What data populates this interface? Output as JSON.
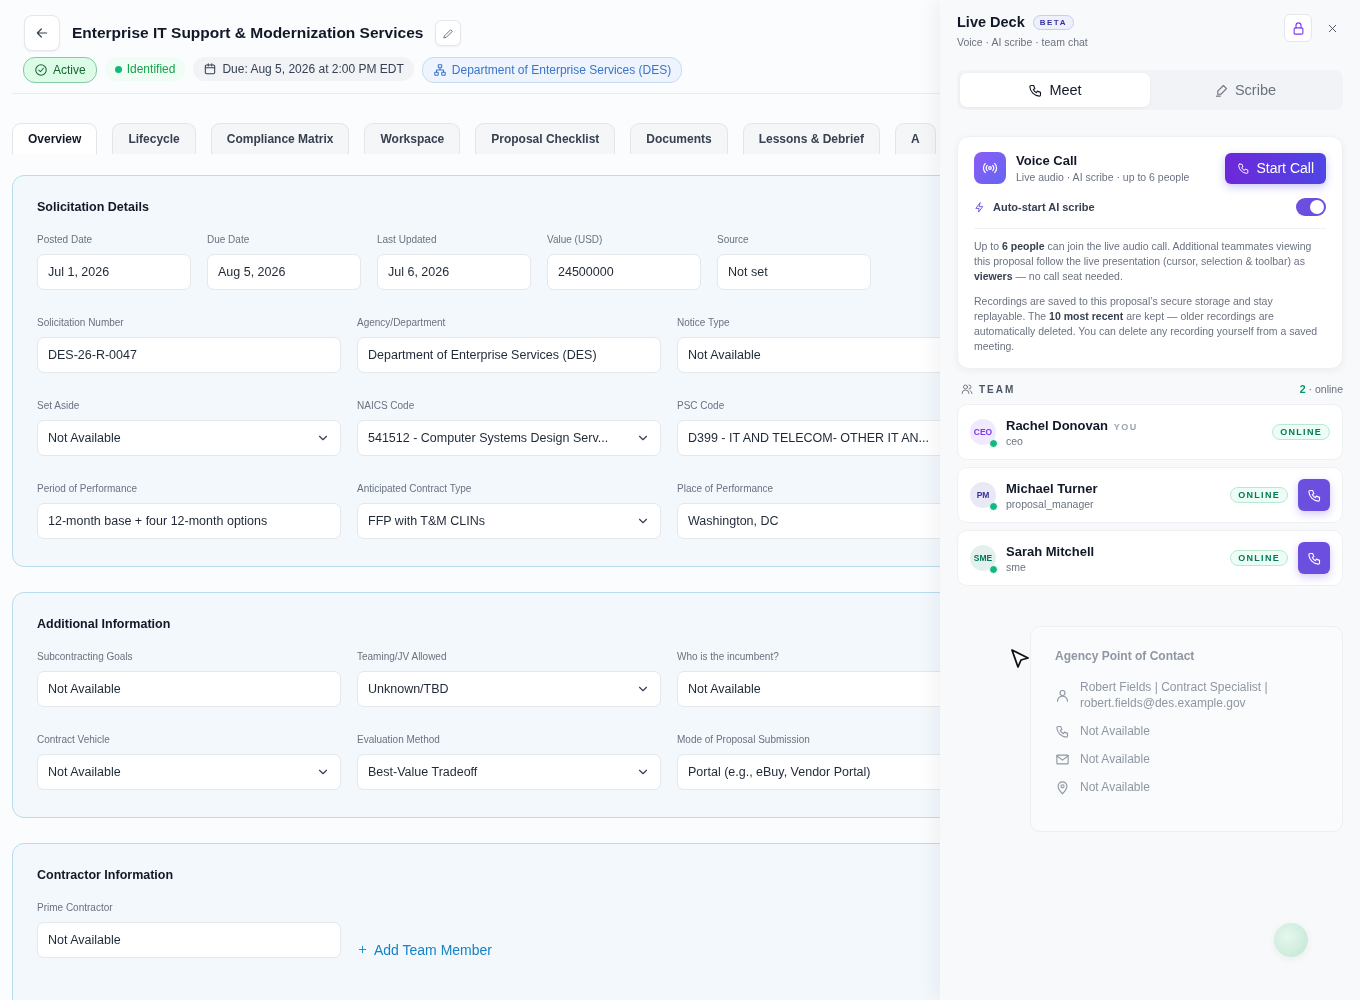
{
  "header": {
    "title": "Enterprise IT Support & Modernization Services",
    "badges": [
      {
        "kind": "status",
        "label": "Active"
      },
      {
        "kind": "stage",
        "label": "Identified"
      },
      {
        "kind": "due",
        "label": "Due: Aug 5, 2026 at 2:00 PM EDT"
      },
      {
        "kind": "agency",
        "label": "Department of Enterprise Services (DES)"
      }
    ]
  },
  "tabs": [
    {
      "label": "Overview",
      "selected": true
    },
    {
      "label": "Lifecycle",
      "selected": false
    },
    {
      "label": "Compliance Matrix",
      "selected": false
    },
    {
      "label": "Workspace",
      "selected": false
    },
    {
      "label": "Proposal Checklist",
      "selected": false
    },
    {
      "label": "Documents",
      "selected": false
    },
    {
      "label": "Lessons & Debrief",
      "selected": false
    },
    {
      "label": "A",
      "selected": false
    }
  ],
  "sections": [
    {
      "title": "Solicitation Details",
      "rows": [
        {
          "kind": "narrow",
          "fields": [
            {
              "label": "Posted Date",
              "value": "Jul 1, 2026",
              "kind": "text"
            },
            {
              "label": "Due Date",
              "value": "Aug 5, 2026",
              "kind": "text"
            },
            {
              "label": "Last Updated",
              "value": "Jul 6, 2026",
              "kind": "text"
            },
            {
              "label": "Value (USD)",
              "value": "24500000",
              "kind": "text"
            },
            {
              "label": "Source",
              "value": "Not set",
              "kind": "text"
            }
          ]
        },
        {
          "kind": "wide",
          "fields": [
            {
              "label": "Solicitation Number",
              "value": "DES-26-R-0047",
              "kind": "text"
            },
            {
              "label": "Agency/Department",
              "value": "Department of Enterprise Services (DES)",
              "kind": "text"
            },
            {
              "label": "Notice Type",
              "value": "Not Available",
              "kind": "text"
            }
          ]
        },
        {
          "kind": "wide",
          "fields": [
            {
              "label": "Set Aside",
              "value": "Not Available",
              "kind": "select"
            },
            {
              "label": "NAICS Code",
              "value": "541512 - Computer Systems Design Serv...",
              "kind": "select"
            },
            {
              "label": "PSC Code",
              "value": "D399 - IT AND TELECOM- OTHER IT AN...",
              "kind": "text"
            }
          ]
        },
        {
          "kind": "wide",
          "fields": [
            {
              "label": "Period of Performance",
              "value": "12-month base + four 12-month options",
              "kind": "text"
            },
            {
              "label": "Anticipated Contract Type",
              "value": "FFP with T&M CLINs",
              "kind": "select"
            },
            {
              "label": "Place of Performance",
              "value": "Washington, DC",
              "kind": "text"
            }
          ]
        }
      ]
    },
    {
      "title": "Additional Information",
      "rows": [
        {
          "kind": "wide",
          "fields": [
            {
              "label": "Subcontracting Goals",
              "value": "Not Available",
              "kind": "text"
            },
            {
              "label": "Teaming/JV Allowed",
              "value": "Unknown/TBD",
              "kind": "select"
            },
            {
              "label": "Who is the incumbent?",
              "value": "Not Available",
              "kind": "text"
            }
          ]
        },
        {
          "kind": "wide",
          "fields": [
            {
              "label": "Contract Vehicle",
              "value": "Not Available",
              "kind": "select"
            },
            {
              "label": "Evaluation Method",
              "value": "Best-Value Tradeoff",
              "kind": "select"
            },
            {
              "label": "Mode of Proposal Submission",
              "value": "Portal (e.g., eBuy, Vendor Portal)",
              "kind": "text"
            }
          ]
        }
      ]
    },
    {
      "title": "Contractor Information",
      "rows": [
        {
          "kind": "wide",
          "fields": [
            {
              "label": "Prime Contractor",
              "value": "Not Available",
              "kind": "text"
            }
          ]
        }
      ],
      "action": "Add Team Member"
    }
  ],
  "live_deck": {
    "title": "Live Deck",
    "badge": "BETA",
    "subtitle": "Voice · AI scribe · team chat",
    "tabs": [
      {
        "label": "Meet",
        "kind": "phone",
        "selected": true
      },
      {
        "label": "Scribe",
        "kind": "pen",
        "selected": false
      }
    ],
    "voice_call": {
      "title": "Voice Call",
      "subtitle": "Live audio · AI scribe · up to 6 people",
      "button": "Start Call"
    },
    "auto_start": {
      "label": "Auto-start AI scribe",
      "on": true
    },
    "notes": [
      "Up to **6 people** can join the live audio call. Additional teammates viewing this proposal follow the live presentation (cursor, selection & toolbar) as **viewers** — no call seat needed.",
      "Recordings are saved to this proposal’s secure storage and stay replayable. The **10 most recent** are kept — older recordings are automatically deleted. You can delete any recording yourself from a saved meeting."
    ],
    "team": {
      "heading": "TEAM",
      "count": "2",
      "count_label": "· online"
    },
    "members": [
      {
        "initials": "CEO",
        "name": "Rachel Donovan",
        "tag": "YOU",
        "role": "ceo",
        "status": "ONLINE",
        "callable": false,
        "color": "#7c3aed"
      },
      {
        "initials": "PM",
        "name": "Michael Turner",
        "role": "proposal_manager",
        "status": "ONLINE",
        "callable": true,
        "color": "#3730a3"
      },
      {
        "initials": "SME",
        "name": "Sarah Mitchell",
        "role": "sme",
        "status": "ONLINE",
        "callable": true,
        "color": "#047857"
      }
    ]
  },
  "contact_card": {
    "title": "Agency Point of Contact",
    "lines": [
      {
        "kind": "person",
        "text": "Robert Fields | Contract Specialist | robert.fields@des.example.gov"
      },
      {
        "kind": "phone",
        "text": "Not Available"
      },
      {
        "kind": "mail",
        "text": "Not Available"
      },
      {
        "kind": "pin",
        "text": "Not Available"
      }
    ]
  }
}
